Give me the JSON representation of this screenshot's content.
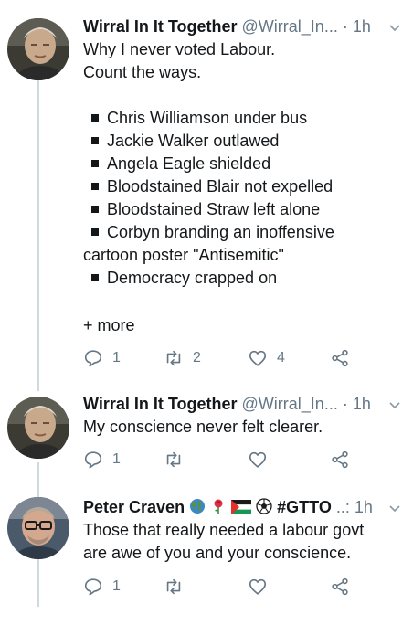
{
  "tweets": [
    {
      "author": "Wirral In It Together",
      "handle": "@Wirral_In...",
      "separator": "·",
      "time": "1h",
      "avatar": "avatar-photo-grey-haired-man",
      "lines": [
        "Why I never voted Labour.",
        "Count the ways.",
        "",
        "Chris Williamson under bus",
        "Jackie Walker outlawed",
        "Angela Eagle shielded",
        "Bloodstained Blair not expelled",
        "Bloodstained Straw left alone",
        "Corbyn branding an inoffensive",
        "cartoon poster \"Antisemitic\"",
        "Democracy crapped on"
      ],
      "more": "+ more",
      "reply_count": "1",
      "retweet_count": "2",
      "like_count": "4"
    },
    {
      "author": "Wirral In It Together",
      "handle": "@Wirral_In...",
      "separator": "·",
      "time": "1h",
      "avatar": "avatar-photo-grey-haired-man",
      "lines": [
        "My conscience never felt clearer."
      ],
      "reply_count": "1",
      "retweet_count": "",
      "like_count": ""
    },
    {
      "author": "Peter Craven",
      "handle": "#GTTO",
      "separator": "..:",
      "time": "1h",
      "avatar": "avatar-photo-man-with-glasses",
      "name_emojis": [
        "globe-icon",
        "red-rose-icon",
        "palestine-flag-icon",
        "football-icon"
      ],
      "lines": [
        "Those that really needed a labour govt",
        "are awe of you and your conscience."
      ],
      "reply_count": "1",
      "retweet_count": "",
      "like_count": ""
    }
  ],
  "colors": {
    "text": "#14171a",
    "secondary": "#657786",
    "thread_line": "#cfd9de",
    "background": "#ffffff"
  }
}
